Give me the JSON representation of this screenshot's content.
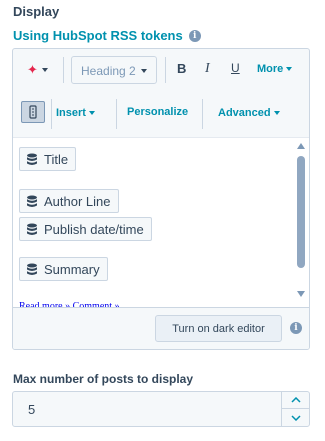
{
  "section": {
    "title": "Display"
  },
  "subtitle": {
    "link": "Using HubSpot RSS tokens",
    "info_icon": "i"
  },
  "toolbar": {
    "sparkle_icon": "✦",
    "heading_select": "Heading 2",
    "bold": "B",
    "italic": "I",
    "underline": "U",
    "more": "More",
    "insert": "Insert",
    "personalize": "Personalize",
    "advanced": "Advanced"
  },
  "tokens": [
    {
      "label": "Title"
    },
    {
      "label": "Author Line"
    },
    {
      "label": "Publish date/time"
    },
    {
      "label": "Summary"
    }
  ],
  "cut_links": "Read more »    Comment »",
  "footer": {
    "dark_editor": "Turn on dark editor",
    "info_icon": "i"
  },
  "max_posts": {
    "label": "Max number of posts to display",
    "value": "5"
  },
  "colors": {
    "accent": "#0091ae",
    "text": "#33475b",
    "border": "#cbd6e2",
    "sparkle": "#e4264c"
  }
}
